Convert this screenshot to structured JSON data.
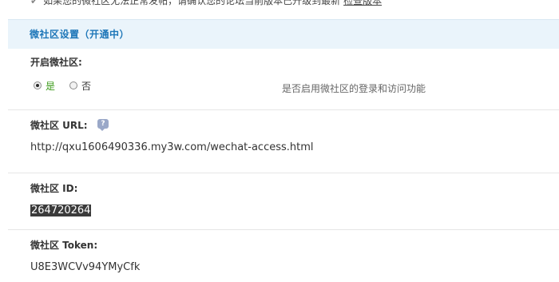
{
  "tip": {
    "text": "如果您的微社区无法正常发帖，请确认您的论坛当前版本已升级到最新",
    "link": "检查版本"
  },
  "section": {
    "title": "微社区设置（开通中）"
  },
  "enable": {
    "label": "开启微社区:",
    "options": [
      "是",
      "否"
    ],
    "selected": "是",
    "hint": "是否启用微社区的登录和访问功能"
  },
  "url": {
    "label": "微社区 URL:",
    "value": "http://qxu1606490336.my3w.com/wechat-access.html"
  },
  "id": {
    "label": "微社区 ID:",
    "value": "264720264"
  },
  "token": {
    "label": "微社区 Token:",
    "value": "U8E3WCVv94YMyCfk"
  }
}
